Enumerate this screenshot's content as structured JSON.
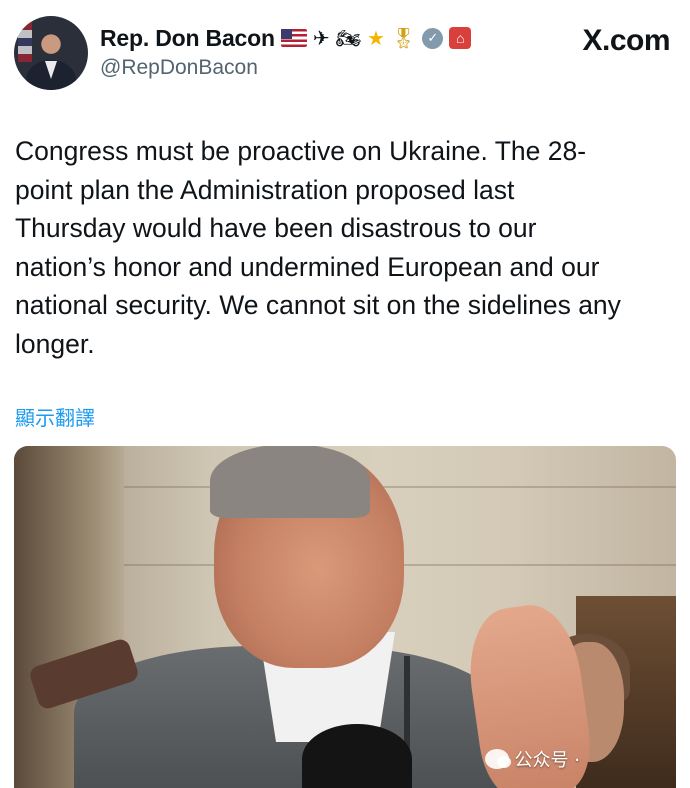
{
  "author": {
    "name": "Rep. Don Bacon",
    "handle": "@RepDonBacon",
    "badges": [
      "us-flag-emoji",
      "airplane-emoji",
      "motorcycle-emoji",
      "star-emoji",
      "medal-emoji",
      "verified-badge-icon",
      "capitol-icon"
    ],
    "verified_color": "#829aab"
  },
  "brand": "X.com",
  "tweet": {
    "text": "Congress must be proactive on Ukraine. The 28-\npoint plan the Administration proposed last\nThursday would have been disastrous to our\nnation’s honor and undermined European and our\nnational security. We cannot sit on the sidelines any\nlonger.",
    "translate_label": "顯示翻譯"
  },
  "media": {
    "watermark": "公众号 ·"
  },
  "colors": {
    "text": "#0f1419",
    "secondary": "#536471",
    "link": "#1d9bf0"
  }
}
